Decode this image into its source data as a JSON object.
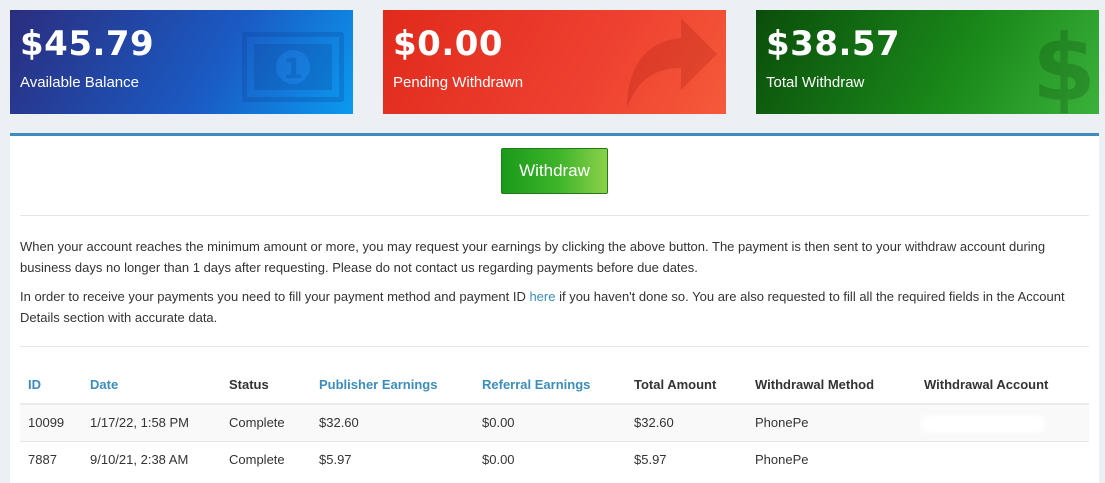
{
  "cards": {
    "balance": {
      "amount": "$45.79",
      "label": "Available Balance",
      "icon": "money-bill-icon",
      "color": "#1a5bc4"
    },
    "pending": {
      "amount": "$0.00",
      "label": "Pending Withdrawn",
      "icon": "share-arrow-icon",
      "color": "#ee4030"
    },
    "total": {
      "amount": "$38.57",
      "label": "Total Withdraw",
      "icon": "dollar-sign-icon",
      "color": "#1a8a1a"
    }
  },
  "withdraw_button": {
    "label": "Withdraw",
    "color": "#3fb52a"
  },
  "info": {
    "paragraph1": "When your account reaches the minimum amount or more, you may request your earnings by clicking the above button. The payment is then sent to your withdraw account during business days no longer than 1 days after requesting. Please do not contact us regarding payments before due dates.",
    "paragraph2_before": "In order to receive your payments you need to fill your payment method and payment ID ",
    "paragraph2_link": "here",
    "paragraph2_after": " if you haven't done so. You are also requested to fill all the required fields in the Account Details section with accurate data."
  },
  "table": {
    "headers": {
      "id": "ID",
      "date": "Date",
      "status": "Status",
      "publisher_earnings": "Publisher Earnings",
      "referral_earnings": "Referral Earnings",
      "total_amount": "Total Amount",
      "withdrawal_method": "Withdrawal Method",
      "withdrawal_account": "Withdrawal Account"
    },
    "rows": [
      {
        "id": "10099",
        "date": "1/17/22, 1:58 PM",
        "status": "Complete",
        "publisher_earnings": "$32.60",
        "referral_earnings": "$0.00",
        "total_amount": "$32.60",
        "withdrawal_method": "PhonePe"
      },
      {
        "id": "7887",
        "date": "9/10/21, 2:38 AM",
        "status": "Complete",
        "publisher_earnings": "$5.97",
        "referral_earnings": "$0.00",
        "total_amount": "$5.97",
        "withdrawal_method": "PhonePe"
      }
    ]
  },
  "link_color": "#3c8dbc"
}
